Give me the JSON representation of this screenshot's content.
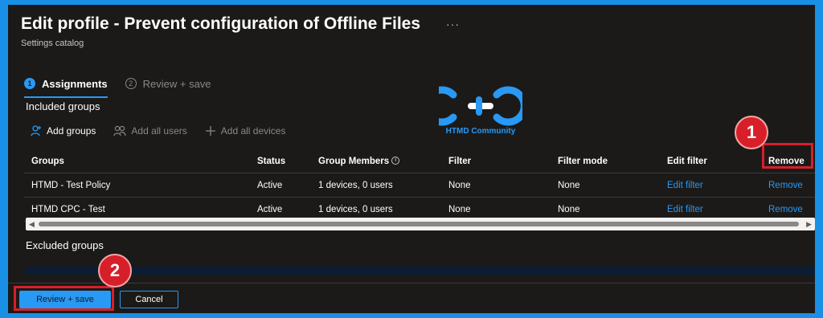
{
  "header": {
    "title": "Edit profile - Prevent configuration of Offline Files",
    "more": "···",
    "subtitle": "Settings catalog"
  },
  "tabs": [
    {
      "number": "1",
      "label": "Assignments",
      "active": true
    },
    {
      "number": "2",
      "label": "Review + save",
      "active": false
    }
  ],
  "watermark": {
    "text": "HTMD Community"
  },
  "included": {
    "label": "Included groups",
    "actions": {
      "add_groups": "Add groups",
      "add_all_users": "Add all users",
      "add_all_devices": "Add all devices"
    },
    "columns": [
      "Groups",
      "Status",
      "Group Members",
      "Filter",
      "Filter mode",
      "Edit filter",
      "Remove"
    ],
    "rows": [
      {
        "group": "HTMD - Test Policy",
        "status": "Active",
        "members": "1 devices, 0 users",
        "filter": "None",
        "filter_mode": "None",
        "edit_filter": "Edit filter",
        "remove": "Remove"
      },
      {
        "group": "HTMD CPC - Test",
        "status": "Active",
        "members": "1 devices, 0 users",
        "filter": "None",
        "filter_mode": "None",
        "edit_filter": "Edit filter",
        "remove": "Remove"
      }
    ]
  },
  "excluded": {
    "label": "Excluded groups"
  },
  "footer": {
    "primary_label": "Review + save",
    "secondary_label": "Cancel"
  },
  "callouts": {
    "one": "1",
    "two": "2"
  },
  "colors": {
    "accent": "#2899f5",
    "callout": "#d71f2a",
    "frame": "#1a8fe6",
    "background": "#1b1a19"
  },
  "icons": [
    "more-icon",
    "person-add-icon",
    "people-icon",
    "plus-icon",
    "info-icon"
  ]
}
